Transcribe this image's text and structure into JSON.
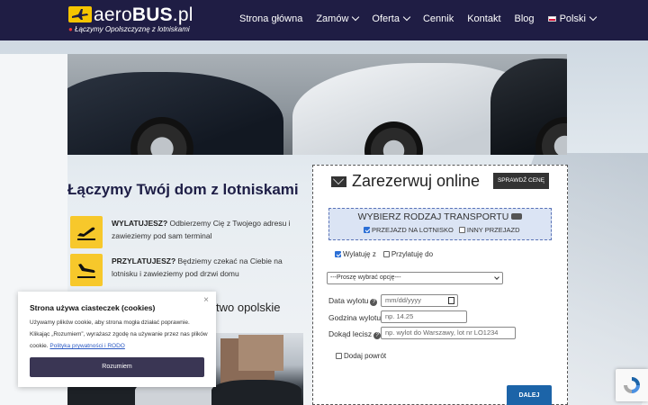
{
  "header": {
    "logo_text_light": "aero",
    "logo_text_bold": "BUS",
    "logo_text_suffix": ".pl",
    "tagline": "Łączymy Opolszczyznę z lotniskami",
    "nav": [
      {
        "label": "Strona główna",
        "dropdown": false
      },
      {
        "label": "Zamów",
        "dropdown": true
      },
      {
        "label": "Oferta",
        "dropdown": true
      },
      {
        "label": "Cennik",
        "dropdown": false
      },
      {
        "label": "Kontakt",
        "dropdown": false
      },
      {
        "label": "Blog",
        "dropdown": false
      },
      {
        "label": "Polski",
        "dropdown": true
      }
    ]
  },
  "main": {
    "title": "Łączymy Twój dom z lotniskami",
    "features": [
      {
        "bold": "WYLATUJESZ?",
        "text": " Odbierzemy Cię z Twojego adresu i zawieziemy pod sam terminal",
        "icon": "takeoff-icon"
      },
      {
        "bold": "PRZYLATUJESZ?",
        "text": " Będziemy czekać na Ciebie na lotnisku i zawieziemy pod drzwi domu",
        "icon": "landing-icon"
      }
    ],
    "subtitle_visible": "two opolskie"
  },
  "form": {
    "title": "Zarezerwuj online",
    "check_price": "SPRAWDŹ CENĘ",
    "transport_title": "WYBIERZ RODZAJ TRANSPORTU",
    "opt_airport": "PRZEJAZD NA LOTNISKO",
    "opt_other": "INNY PRZEJAZD",
    "opt_airport_checked": true,
    "opt_other_checked": false,
    "depart_label": "Wylatuję z",
    "arrive_label": "Przylatuję do",
    "depart_checked": true,
    "arrive_checked": false,
    "select_placeholder": "---Proszę wybrać opcję---",
    "date_label": "Data wylotu",
    "date_placeholder": "mm/dd/yyyy",
    "time_label": "Godzina wylotu",
    "time_placeholder": "np. 14.25",
    "dest_label": "Dokąd lecisz",
    "dest_placeholder": "np. wylot do Warszawy, lot nr LO1234",
    "return_label": "Dodaj powrót",
    "next_label": "DALEJ"
  },
  "cookie": {
    "title": "Strona używa ciasteczek (cookies)",
    "text": "Używamy plików cookie, aby strona mogła działać poprawnie. Klikając „Rozumiem”, wyrażasz zgodę na używanie przez nas plików cookie. ",
    "link": "Polityka prywatności i RODO",
    "button": "Rozumiem",
    "close": "×"
  },
  "colors": {
    "header_bg": "#1f1d44",
    "accent_yellow": "#f7c82b",
    "button_blue": "#1c64a8",
    "cookie_button": "#3a3654"
  }
}
